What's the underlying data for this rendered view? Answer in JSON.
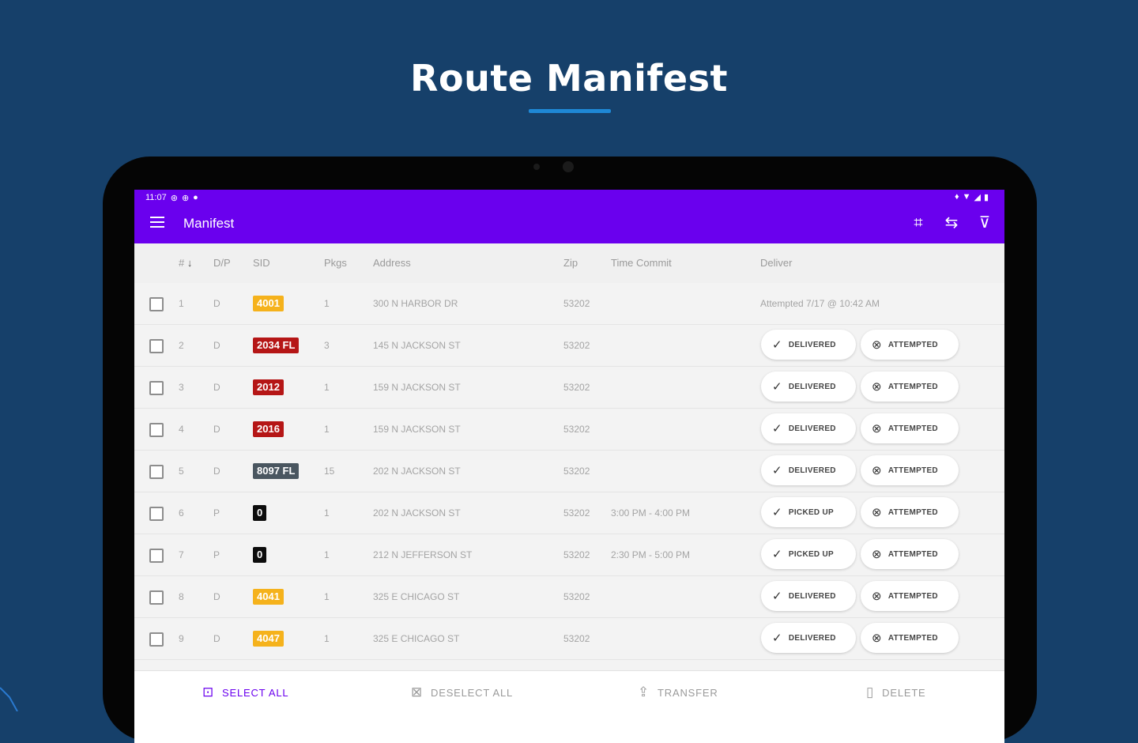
{
  "promo": {
    "title": "Route Manifest"
  },
  "status_bar": {
    "time": "11:07"
  },
  "app_bar": {
    "title": "Manifest"
  },
  "columns": {
    "num": "#",
    "dp": "D/P",
    "sid": "SID",
    "pkgs": "Pkgs",
    "address": "Address",
    "zip": "Zip",
    "time_commit": "Time Commit",
    "deliver": "Deliver"
  },
  "rows": [
    {
      "num": "1",
      "dp": "D",
      "sid": "4001",
      "sid_color": "#f5b21c",
      "pkgs": "1",
      "address": "300 N HARBOR DR",
      "zip": "53202",
      "time": "",
      "deliver_status": "Attempted 7/17 @ 10:42 AM"
    },
    {
      "num": "2",
      "dp": "D",
      "sid": "2034 FL",
      "sid_color": "#b51616",
      "pkgs": "3",
      "address": "145 N JACKSON ST",
      "zip": "53202",
      "time": "",
      "primary_btn": "DELIVERED",
      "secondary_btn": "ATTEMPTED"
    },
    {
      "num": "3",
      "dp": "D",
      "sid": "2012",
      "sid_color": "#b51616",
      "pkgs": "1",
      "address": "159 N JACKSON ST",
      "zip": "53202",
      "time": "",
      "primary_btn": "DELIVERED",
      "secondary_btn": "ATTEMPTED"
    },
    {
      "num": "4",
      "dp": "D",
      "sid": "2016",
      "sid_color": "#b51616",
      "pkgs": "1",
      "address": "159 N JACKSON ST",
      "zip": "53202",
      "time": "",
      "primary_btn": "DELIVERED",
      "secondary_btn": "ATTEMPTED"
    },
    {
      "num": "5",
      "dp": "D",
      "sid": "8097 FL",
      "sid_color": "#4a5660",
      "pkgs": "15",
      "address": "202 N JACKSON ST",
      "zip": "53202",
      "time": "",
      "primary_btn": "DELIVERED",
      "secondary_btn": "ATTEMPTED"
    },
    {
      "num": "6",
      "dp": "P",
      "sid": "0",
      "sid_color": "#0c0c0c",
      "pkgs": "1",
      "address": "202 N JACKSON ST",
      "zip": "53202",
      "time": "3:00 PM - 4:00 PM",
      "primary_btn": "PICKED UP",
      "secondary_btn": "ATTEMPTED"
    },
    {
      "num": "7",
      "dp": "P",
      "sid": "0",
      "sid_color": "#0c0c0c",
      "pkgs": "1",
      "address": "212 N JEFFERSON ST",
      "zip": "53202",
      "time": "2:30 PM - 5:00 PM",
      "primary_btn": "PICKED UP",
      "secondary_btn": "ATTEMPTED"
    },
    {
      "num": "8",
      "dp": "D",
      "sid": "4041",
      "sid_color": "#f5b21c",
      "pkgs": "1",
      "address": "325 E CHICAGO ST",
      "zip": "53202",
      "time": "",
      "primary_btn": "DELIVERED",
      "secondary_btn": "ATTEMPTED"
    },
    {
      "num": "9",
      "dp": "D",
      "sid": "4047",
      "sid_color": "#f5b21c",
      "pkgs": "1",
      "address": "325 E CHICAGO ST",
      "zip": "53202",
      "time": "",
      "primary_btn": "DELIVERED",
      "secondary_btn": "ATTEMPTED"
    }
  ],
  "bottom_bar": {
    "select_all": "SELECT ALL",
    "deselect_all": "DESELECT ALL",
    "transfer": "TRANSFER",
    "delete": "DELETE"
  },
  "colors": {
    "background": "#16406a",
    "app_bar": "#6a00ee",
    "accent_underline": "#1e88d6",
    "select_all": "#6a00ee"
  }
}
